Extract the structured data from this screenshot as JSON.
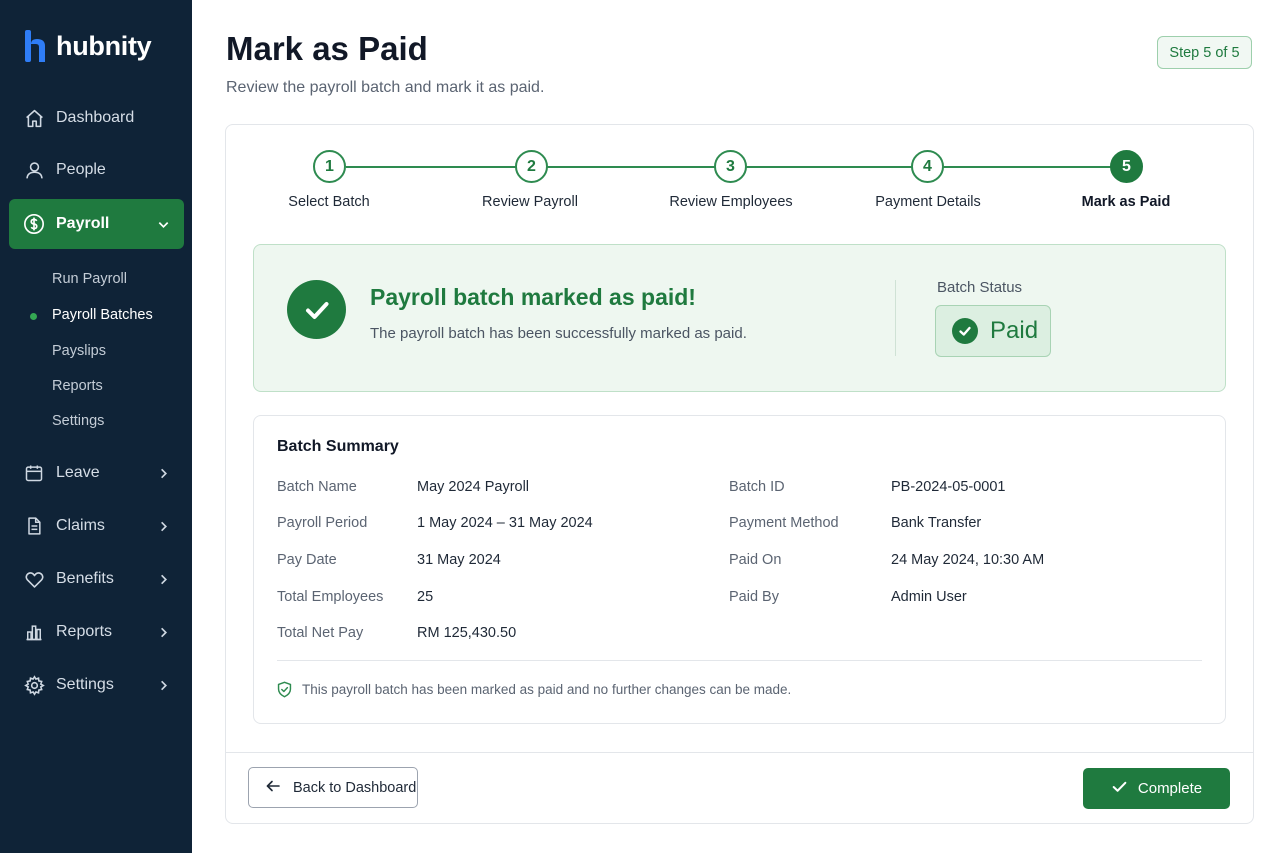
{
  "app": {
    "name": "hubnity"
  },
  "sidebar": {
    "items": [
      {
        "label": "Dashboard",
        "icon": "home-icon"
      },
      {
        "label": "People",
        "icon": "user-icon"
      },
      {
        "label": "Payroll",
        "icon": "dollar-circle-icon",
        "active": true,
        "expanded": true
      },
      {
        "label": "Leave",
        "icon": "calendar-icon"
      },
      {
        "label": "Claims",
        "icon": "document-icon"
      },
      {
        "label": "Benefits",
        "icon": "heart-icon"
      },
      {
        "label": "Reports",
        "icon": "bar-chart-icon"
      },
      {
        "label": "Settings",
        "icon": "gear-icon"
      }
    ],
    "payroll_sub": [
      {
        "label": "Run Payroll"
      },
      {
        "label": "Payroll Batches",
        "active": true
      },
      {
        "label": "Payslips"
      },
      {
        "label": "Reports"
      },
      {
        "label": "Settings"
      }
    ]
  },
  "header": {
    "title": "Mark as Paid",
    "subtitle": "Review the payroll batch and mark it as paid.",
    "step_badge": "Step 5 of 5"
  },
  "stepper": {
    "steps": [
      {
        "number": "1",
        "label": "Select Batch"
      },
      {
        "number": "2",
        "label": "Review Payroll"
      },
      {
        "number": "3",
        "label": "Review Employees"
      },
      {
        "number": "4",
        "label": "Payment Details"
      },
      {
        "number": "5",
        "label": "Mark as Paid",
        "current": true
      }
    ]
  },
  "success": {
    "title": "Payroll batch marked as paid!",
    "message": "The payroll batch has been successfully marked as paid.",
    "status_label": "Batch Status",
    "status_value": "Paid"
  },
  "summary": {
    "title": "Batch Summary",
    "left": [
      {
        "key": "Batch Name",
        "value": "May 2024 Payroll"
      },
      {
        "key": "Payroll Period",
        "value": "1 May 2024 – 31 May 2024"
      },
      {
        "key": "Pay Date",
        "value": "31 May 2024"
      },
      {
        "key": "Total Employees",
        "value": "25"
      },
      {
        "key": "Total Net Pay",
        "value": "RM 125,430.50"
      }
    ],
    "right": [
      {
        "key": "Batch ID",
        "value": "PB-2024-05-0001"
      },
      {
        "key": "Payment Method",
        "value": "Bank Transfer"
      },
      {
        "key": "Paid On",
        "value": "24 May 2024, 10:30 AM"
      },
      {
        "key": "Paid By",
        "value": "Admin User"
      }
    ],
    "note": "This payroll batch has been marked as paid and no further changes can be made."
  },
  "footer": {
    "back_label": "Back to Dashboard",
    "complete_label": "Complete"
  },
  "colors": {
    "sidebar_bg": "#0f2337",
    "accent": "#1f7a3f",
    "success_bg": "#eef7f0"
  }
}
